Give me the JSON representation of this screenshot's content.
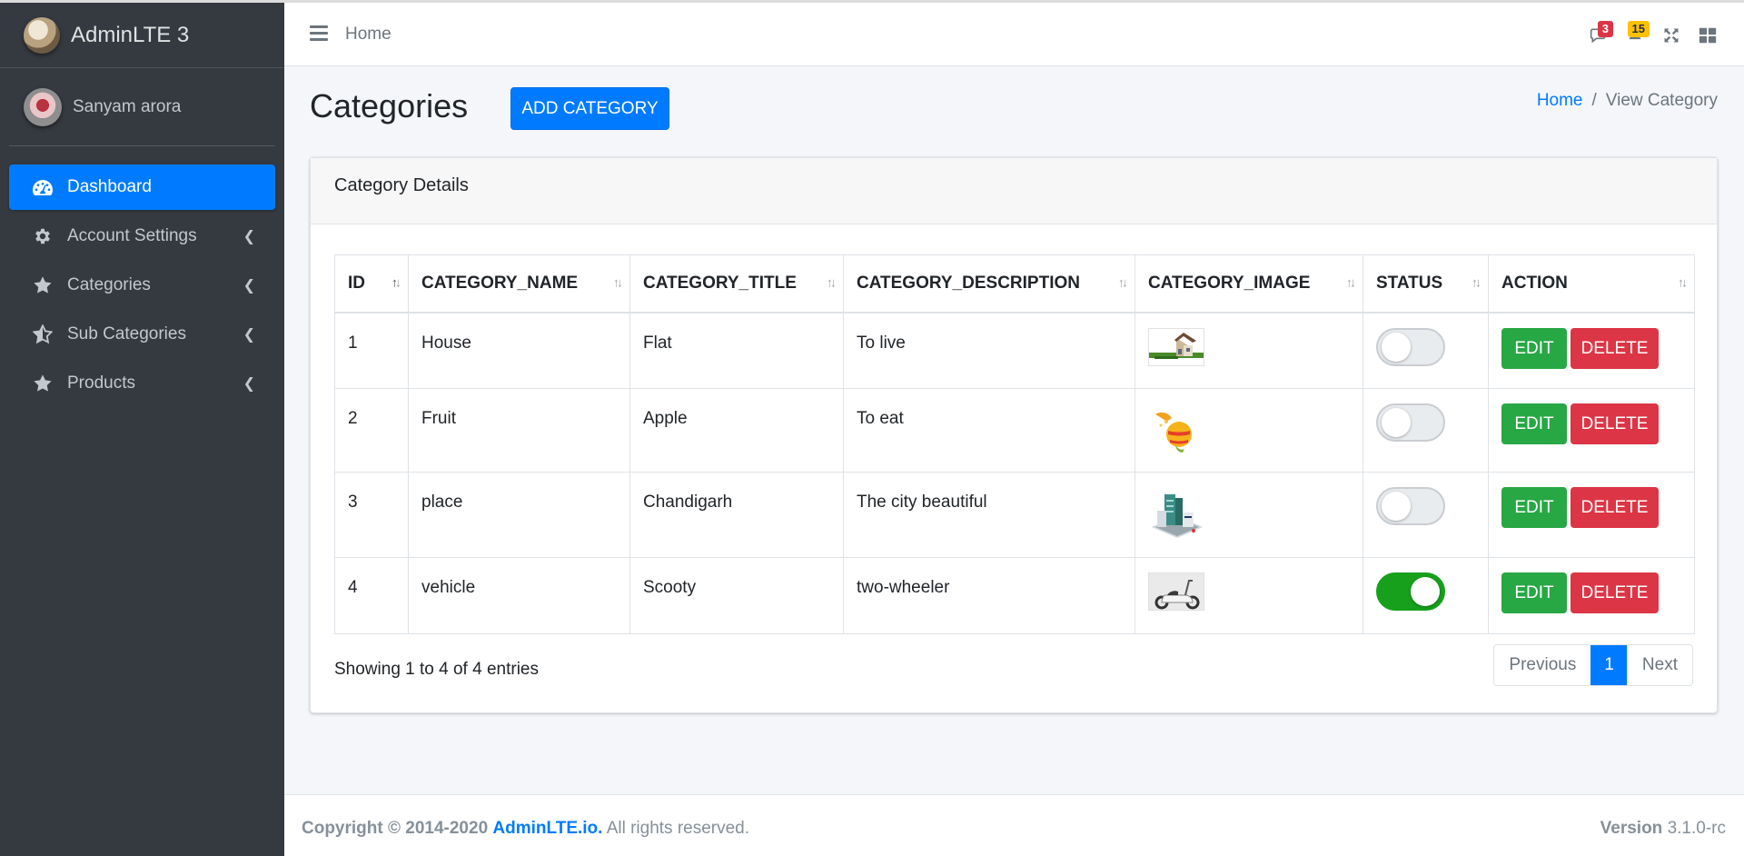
{
  "brand": {
    "name": "AdminLTE 3"
  },
  "user": {
    "name": "Sanyam arora"
  },
  "sidebar": {
    "items": [
      {
        "label": "Dashboard",
        "icon": "tachometer-icon",
        "active": true
      },
      {
        "label": "Account Settings",
        "icon": "gear-icon"
      },
      {
        "label": "Categories",
        "icon": "star-icon"
      },
      {
        "label": "Sub Categories",
        "icon": "star-half-icon"
      },
      {
        "label": "Products",
        "icon": "star-icon"
      }
    ]
  },
  "topbar": {
    "home_label": "Home",
    "messages_badge": "3",
    "notifications_badge": "15"
  },
  "header": {
    "title": "Categories",
    "add_button": "ADD CATEGORY",
    "breadcrumb": {
      "home": "Home",
      "separator": "/",
      "current": "View Category"
    }
  },
  "card": {
    "title": "Category Details"
  },
  "table": {
    "columns": [
      "ID",
      "CATEGORY_NAME",
      "CATEGORY_TITLE",
      "CATEGORY_DESCRIPTION",
      "CATEGORY_IMAGE",
      "STATUS",
      "ACTION"
    ],
    "rows": [
      {
        "id": "1",
        "name": "House",
        "title": "Flat",
        "description": "To live",
        "image": "house-thumbnail",
        "status": false
      },
      {
        "id": "2",
        "name": "Fruit",
        "title": "Apple",
        "description": "To eat",
        "image": "fruit-thumbnail",
        "status": false
      },
      {
        "id": "3",
        "name": "place",
        "title": "Chandigarh",
        "description": "The city beautiful",
        "image": "city-thumbnail",
        "status": false
      },
      {
        "id": "4",
        "name": "vehicle",
        "title": "Scooty",
        "description": "two-wheeler",
        "image": "scooter-thumbnail",
        "status": true
      }
    ],
    "edit_label": "EDIT",
    "delete_label": "DELETE"
  },
  "footer_table": {
    "info": "Showing 1 to 4 of 4 entries",
    "pagination": {
      "previous": "Previous",
      "page": "1",
      "next": "Next"
    }
  },
  "footer": {
    "copyright": "Copyright © 2014-2020",
    "link": "AdminLTE.io.",
    "rights": "All rights reserved.",
    "version_label": "Version",
    "version": "3.1.0-rc"
  },
  "colors": {
    "primary": "#007bff",
    "success": "#28a745",
    "danger": "#dc3545",
    "warning": "#ffc107",
    "sidebar": "#343a40"
  }
}
